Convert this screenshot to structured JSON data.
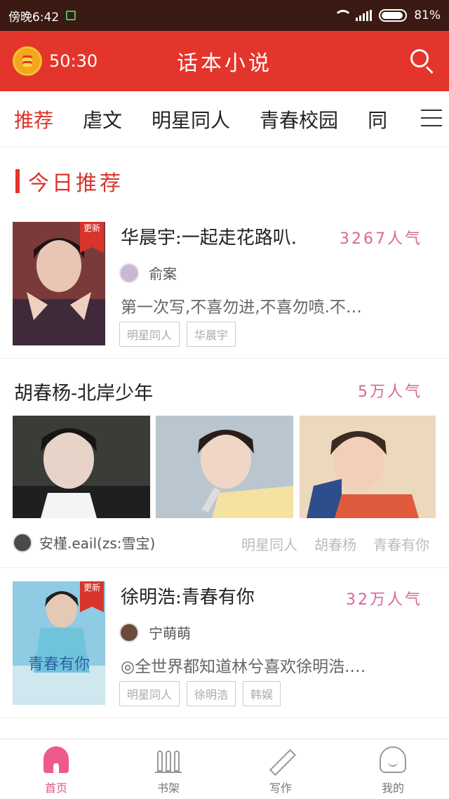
{
  "status_bar": {
    "time": "傍晚6:42",
    "battery": "81%"
  },
  "header": {
    "timer": "50:30",
    "title": "话本小说"
  },
  "tabs": [
    "推荐",
    "虐文",
    "明星同人",
    "青春校园",
    "同"
  ],
  "section": {
    "title": "今日推荐"
  },
  "books": [
    {
      "badge": "更新",
      "title": "华晨宇:一起走花路叭.",
      "popularity": "3267人气",
      "author": "俞案",
      "desc": "第一次写,不喜勿进,不喜勿喷.不…",
      "tags": [
        "明星同人",
        "华晨宇"
      ]
    },
    {
      "badge": "更新",
      "title": "徐明浩:青春有你",
      "popularity": "32万人气",
      "author": "宁萌萌",
      "desc": "◎全世界都知道林兮喜欢徐明浩.…",
      "tags": [
        "明星同人",
        "徐明浩",
        "韩娱"
      ],
      "cover_text": "青春有你"
    }
  ],
  "multi_book": {
    "title": "胡春杨-北岸少年",
    "popularity": "5万人气",
    "author": "安槿.eail(zs:雪宝)",
    "tags": [
      "明星同人",
      "胡春杨",
      "青春有你"
    ]
  },
  "bottom_nav": [
    "首页",
    "书架",
    "写作",
    "我的"
  ],
  "colors": {
    "accent": "#e4352c",
    "popularity": "#d9679a",
    "status_bar": "#3a1a12"
  }
}
